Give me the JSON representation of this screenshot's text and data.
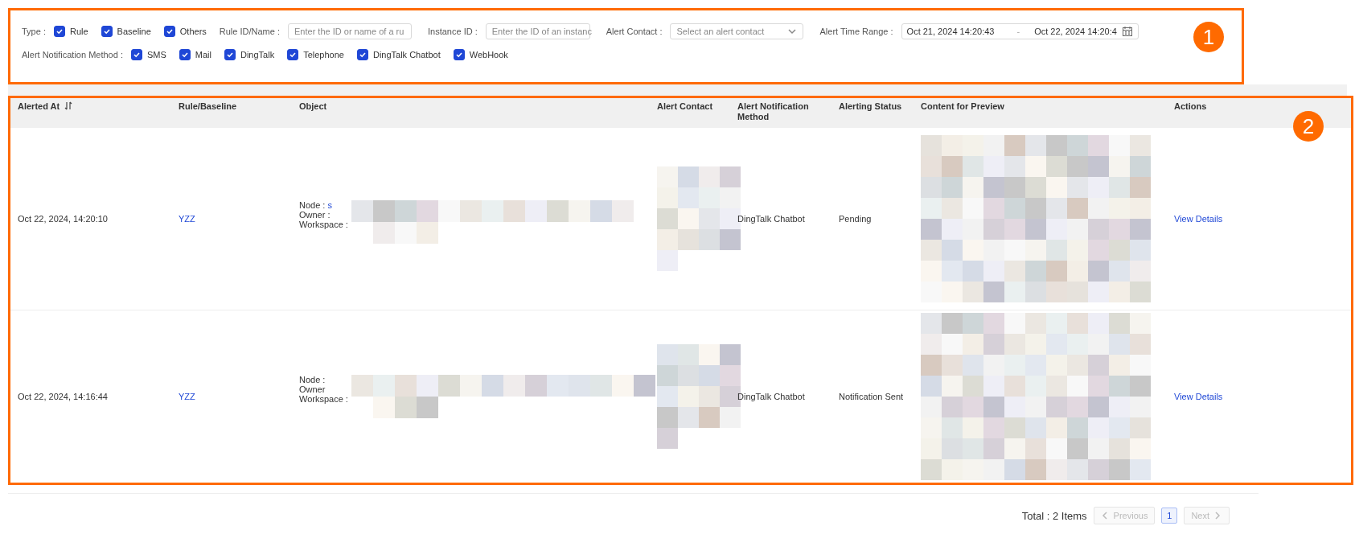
{
  "filters": {
    "type_label": "Type :",
    "type_options": [
      {
        "label": "Rule",
        "checked": true
      },
      {
        "label": "Baseline",
        "checked": true
      },
      {
        "label": "Others",
        "checked": true
      }
    ],
    "rule_field": {
      "label": "Rule ID/Name :",
      "placeholder": "Enter the ID or name of a ru"
    },
    "instance_field": {
      "label": "Instance ID :",
      "placeholder": "Enter the ID of an instanc"
    },
    "contact_field": {
      "label": "Alert Contact :",
      "placeholder": "Select an alert contact"
    },
    "time_range": {
      "label": "Alert Time Range :",
      "start": "Oct 21, 2024 14:20:43",
      "separator": "-",
      "end": "Oct 22, 2024 14:20:4"
    },
    "method_label": "Alert Notification Method :",
    "method_options": [
      {
        "label": "SMS",
        "checked": true
      },
      {
        "label": "Mail",
        "checked": true
      },
      {
        "label": "DingTalk",
        "checked": true
      },
      {
        "label": "Telephone",
        "checked": true
      },
      {
        "label": "DingTalk Chatbot",
        "checked": true
      },
      {
        "label": "WebHook",
        "checked": true
      }
    ]
  },
  "table": {
    "columns": [
      {
        "label": "Alerted At",
        "sortable": true
      },
      {
        "label": "Rule/Baseline",
        "sortable": false
      },
      {
        "label": "Object",
        "sortable": false
      },
      {
        "label": "Alert Contact",
        "sortable": false
      },
      {
        "label": "Alert Notification Method",
        "sortable": false
      },
      {
        "label": "Alerting Status",
        "sortable": false
      },
      {
        "label": "Content for Preview",
        "sortable": false
      },
      {
        "label": "Actions",
        "sortable": false
      }
    ],
    "rows": [
      {
        "alerted_at": "Oct 22, 2024, 14:20:10",
        "rule": "YZZ",
        "object": {
          "node_label": "Node :",
          "node_value": "s",
          "owner_label": "Owner :",
          "workspace_label": "Workspace :"
        },
        "method": "DingTalk Chatbot",
        "status": "Pending",
        "action": "View Details"
      },
      {
        "alerted_at": "Oct 22, 2024, 14:16:44",
        "rule": "YZZ",
        "object": {
          "node_label": "Node :",
          "owner_label": "Owner",
          "workspace_label": "Workspace :"
        },
        "method": "DingTalk Chatbot",
        "status": "Notification Sent",
        "action": "View Details"
      }
    ]
  },
  "pagination": {
    "total": "Total : 2 Items",
    "previous": {
      "label": "Previous",
      "disabled": true
    },
    "pages": [
      {
        "label": "1",
        "selected": true
      }
    ],
    "next": {
      "label": "Next",
      "disabled": true
    }
  },
  "annotations": [
    {
      "label": "1"
    },
    {
      "label": "2"
    }
  ]
}
